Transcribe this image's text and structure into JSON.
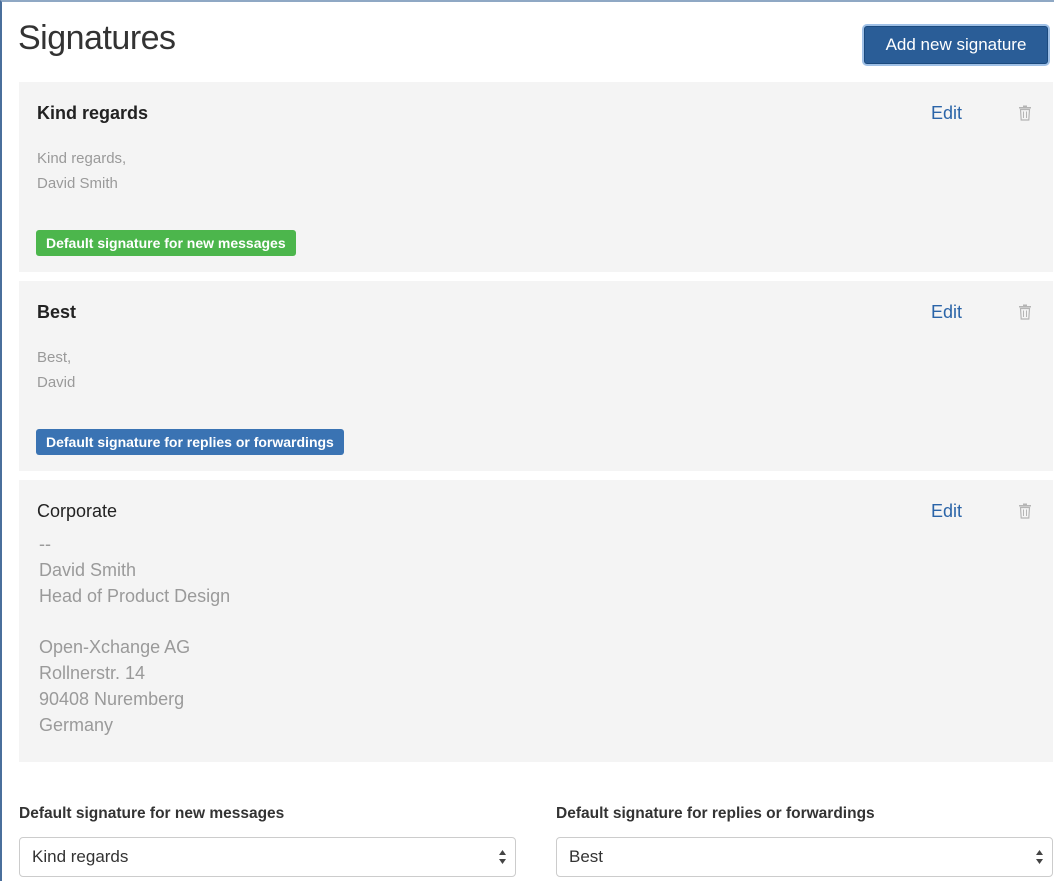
{
  "header": {
    "title": "Signatures",
    "add_button_label": "Add new signature"
  },
  "signatures": [
    {
      "title": "Kind regards",
      "edit_label": "Edit",
      "body": "Kind regards,\nDavid Smith",
      "badge": "Default signature for new messages"
    },
    {
      "title": "Best",
      "edit_label": "Edit",
      "body": "Best,\nDavid",
      "badge": "Default signature for replies or forwardings"
    },
    {
      "title": "Corporate",
      "edit_label": "Edit",
      "body": "--\nDavid Smith\nHead of Product Design\n\nOpen-Xchange AG\nRollnerstr. 14\n90408 Nuremberg\nGermany"
    }
  ],
  "defaults": {
    "new_messages": {
      "label": "Default signature for new messages",
      "selected": "Kind regards"
    },
    "replies": {
      "label": "Default signature for replies or forwardings",
      "selected": "Best"
    }
  },
  "icons": {
    "delete": "trash-icon",
    "select": "sort-arrows-icon"
  },
  "colors": {
    "primary": "#2a5d97",
    "link": "#2a64a8",
    "badge_new": "#4cb64c",
    "badge_reply": "#3a73b3",
    "card_bg": "#f4f4f4"
  }
}
